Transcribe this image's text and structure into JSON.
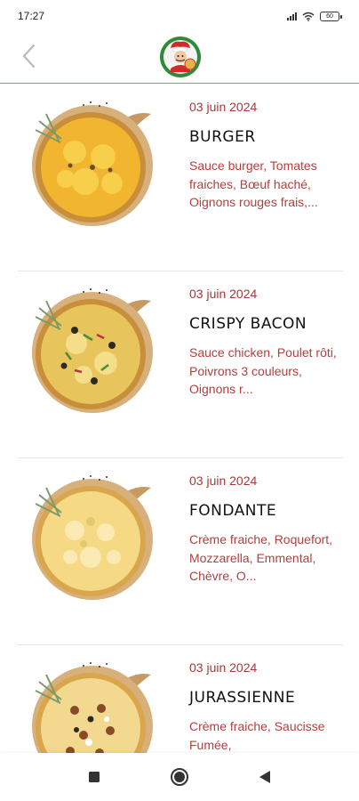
{
  "status_bar": {
    "time": "17:27",
    "battery": "60"
  },
  "header": {
    "back_icon": "chevron-left-icon",
    "logo": "chef-pizza-logo"
  },
  "items": [
    {
      "date": "03 juin 2024",
      "name": "BURGER",
      "description": "Sauce burger, Tomates fraiches, Bœuf haché, Oignons rouges frais,...",
      "image": "pizza-burger"
    },
    {
      "date": "03 juin 2024",
      "name": "CRISPY BACON",
      "description": "Sauce chicken, Poulet rôti, Poivrons 3 couleurs, Oignons r...",
      "image": "pizza-crispy-bacon"
    },
    {
      "date": "03 juin 2024",
      "name": "FONDANTE",
      "description": "Crème fraiche, Roquefort, Mozzarella, Emmental, Chèvre, O...",
      "image": "pizza-fondante"
    },
    {
      "date": "03 juin 2024",
      "name": "JURASSIENNE",
      "description": "Crème fraiche, Saucisse Fumée,",
      "image": "pizza-jurassienne"
    }
  ],
  "nav_bar": {
    "recents_icon": "square-icon",
    "home_icon": "circle-icon",
    "back_icon": "triangle-back-icon"
  },
  "colors": {
    "accent": "#a33a3a",
    "description": "#b1403f",
    "header_border": "#b98a8a"
  }
}
